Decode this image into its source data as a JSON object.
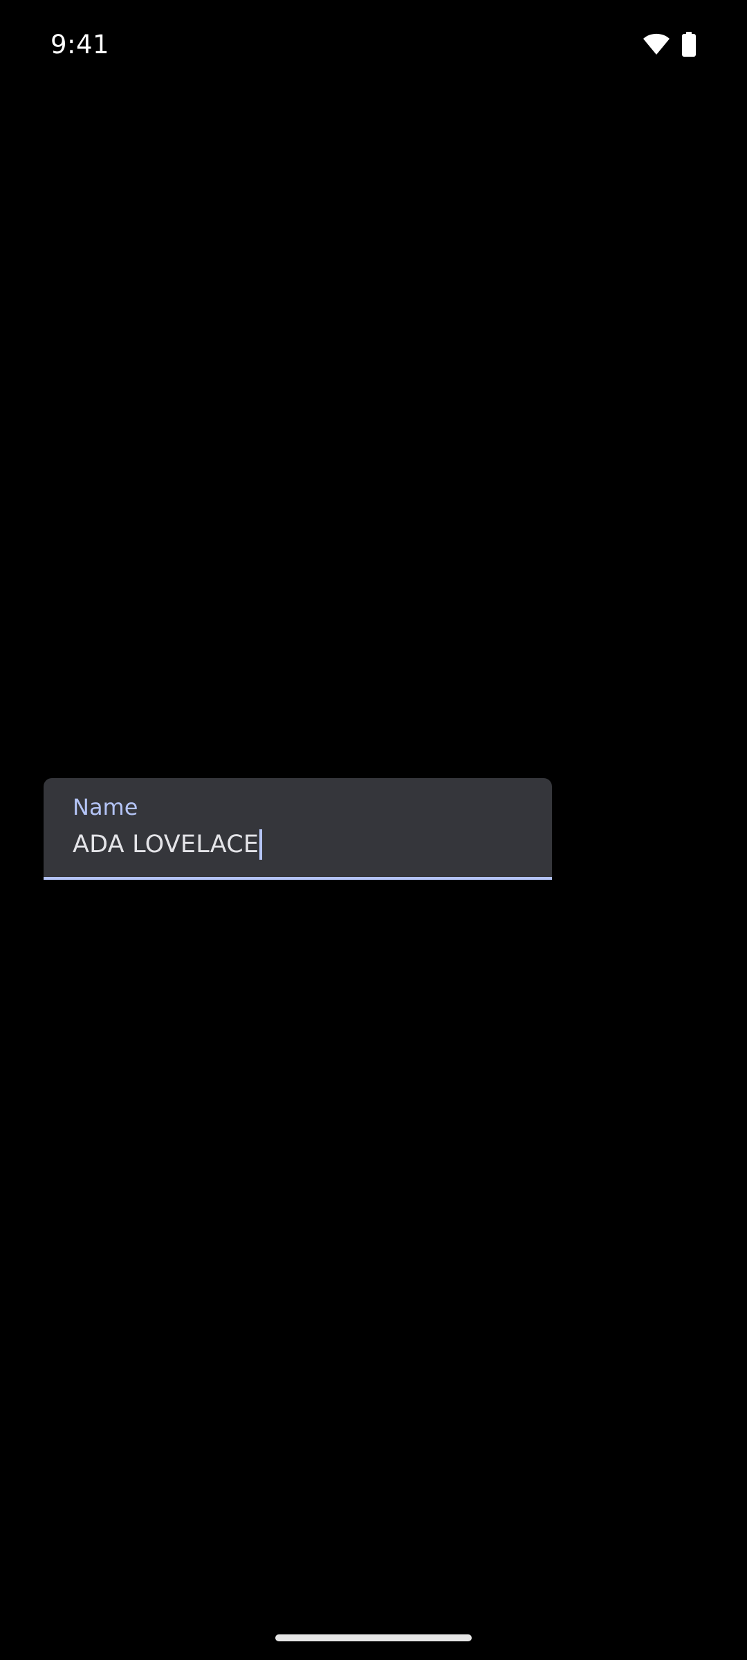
{
  "status_bar": {
    "time": "9:41",
    "icons": [
      "wifi-icon",
      "battery-icon"
    ]
  },
  "name_field": {
    "label": "Name",
    "value": "ADA LOVELACE"
  },
  "colors": {
    "background": "#000000",
    "field_background": "#35363b",
    "accent": "#b4c4f6",
    "text": "#e4e4e8"
  }
}
